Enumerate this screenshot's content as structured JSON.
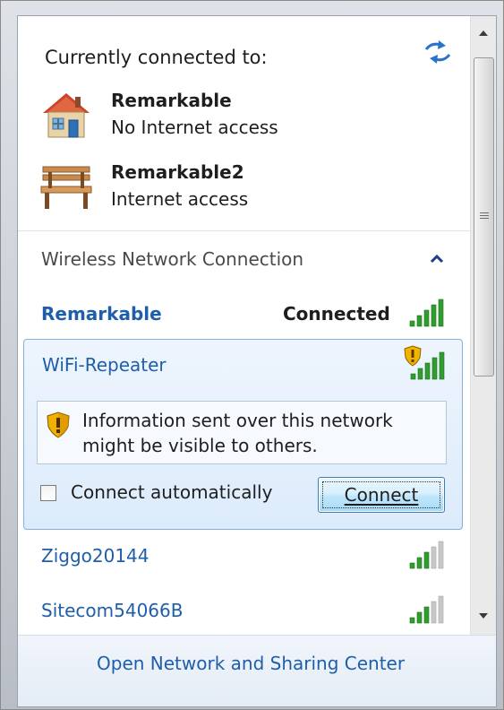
{
  "header": {
    "label": "Currently connected to:",
    "refresh_icon": "refresh-arrows-icon"
  },
  "connections": [
    {
      "name": "Remarkable",
      "status": "No Internet access",
      "icon": "home-network-icon"
    },
    {
      "name": "Remarkable2",
      "status": "Internet access",
      "icon": "public-network-bench-icon"
    }
  ],
  "wireless": {
    "section_title": "Wireless Network Connection",
    "collapse_icon": "chevron-up-icon",
    "networks": [
      {
        "name": "Remarkable",
        "state": "Connected",
        "signal_bars": 5,
        "secured": true
      },
      {
        "name": "WiFi-Repeater",
        "state": "",
        "signal_bars": 5,
        "secured": false
      },
      {
        "name": "Ziggo20144",
        "state": "",
        "signal_bars": 3,
        "secured": true
      },
      {
        "name": "Sitecom54066B",
        "state": "",
        "signal_bars": 3,
        "secured": true
      }
    ],
    "selected": {
      "warning_text": "Information sent over this network might be visible to others.",
      "connect_automatically_label": "Connect automatically",
      "connect_automatically_checked": false,
      "connect_button": "Connect"
    }
  },
  "footer": {
    "link": "Open Network and Sharing Center"
  },
  "colors": {
    "link": "#1f5ea8",
    "signal_on": "#2f9e2f",
    "signal_off": "#c8c8c8",
    "selected_border": "#86b1dc"
  }
}
